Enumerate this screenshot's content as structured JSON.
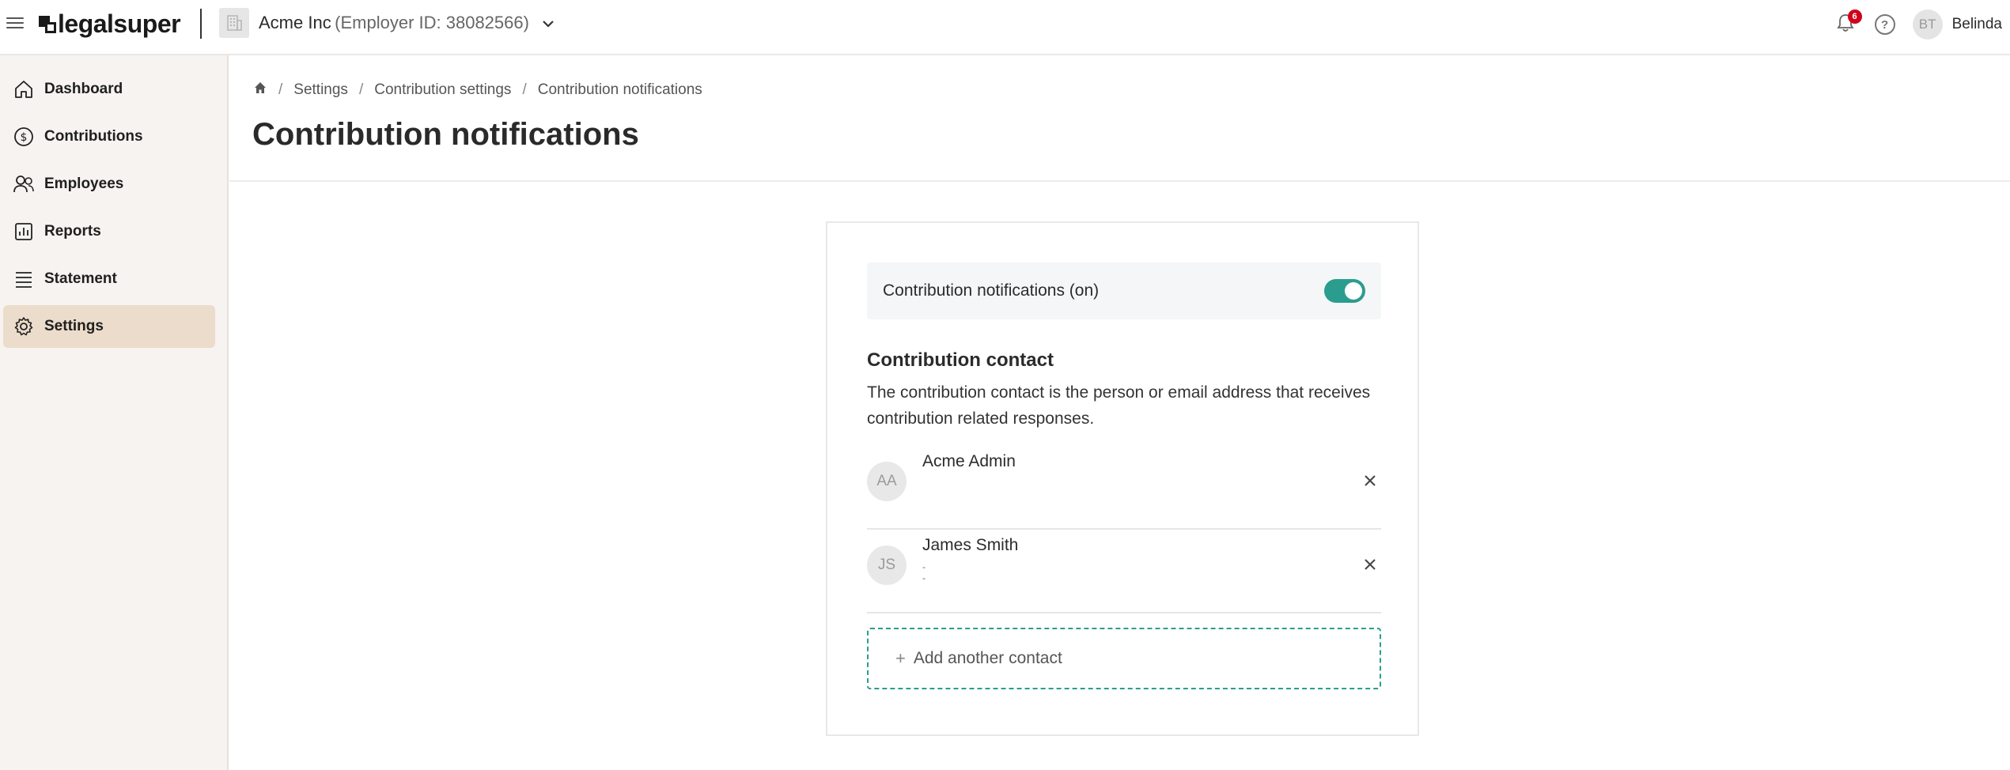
{
  "app": {
    "logo_text": "legalsuper",
    "employer_name": "Acme Inc",
    "employer_id": "(Employer ID: 38082566)",
    "notifications_count": "6",
    "user_initials": "BT",
    "user_name": "Belinda"
  },
  "sidebar": {
    "items": [
      {
        "label": "Dashboard",
        "icon": "home-icon",
        "active": false
      },
      {
        "label": "Contributions",
        "icon": "dollar-circle-icon",
        "active": false
      },
      {
        "label": "Employees",
        "icon": "people-icon",
        "active": false
      },
      {
        "label": "Reports",
        "icon": "bar-chart-icon",
        "active": false
      },
      {
        "label": "Statement",
        "icon": "list-icon",
        "active": false
      },
      {
        "label": "Settings",
        "icon": "gear-icon",
        "active": true
      }
    ]
  },
  "breadcrumb": {
    "items": [
      "Settings",
      "Contribution settings",
      "Contribution notifications"
    ]
  },
  "page": {
    "title": "Contribution notifications"
  },
  "card": {
    "toggle_label": "Contribution notifications (on)",
    "toggle_on": true,
    "section_title": "Contribution contact",
    "section_desc": "The contribution contact is the person or email address that receives contribution related responses.",
    "contacts": [
      {
        "initials": "AA",
        "name": "Acme Admin",
        "sub_line_1": "",
        "sub_line_2": ""
      },
      {
        "initials": "JS",
        "name": "James Smith",
        "sub_line_1": "-",
        "sub_line_2": "-"
      }
    ],
    "add_label": "Add another contact"
  },
  "colors": {
    "accent": "#2a9d8f",
    "sidebar_bg": "#f6f3f0",
    "sidebar_active": "#ecdccb",
    "badge": "#d0021b"
  }
}
